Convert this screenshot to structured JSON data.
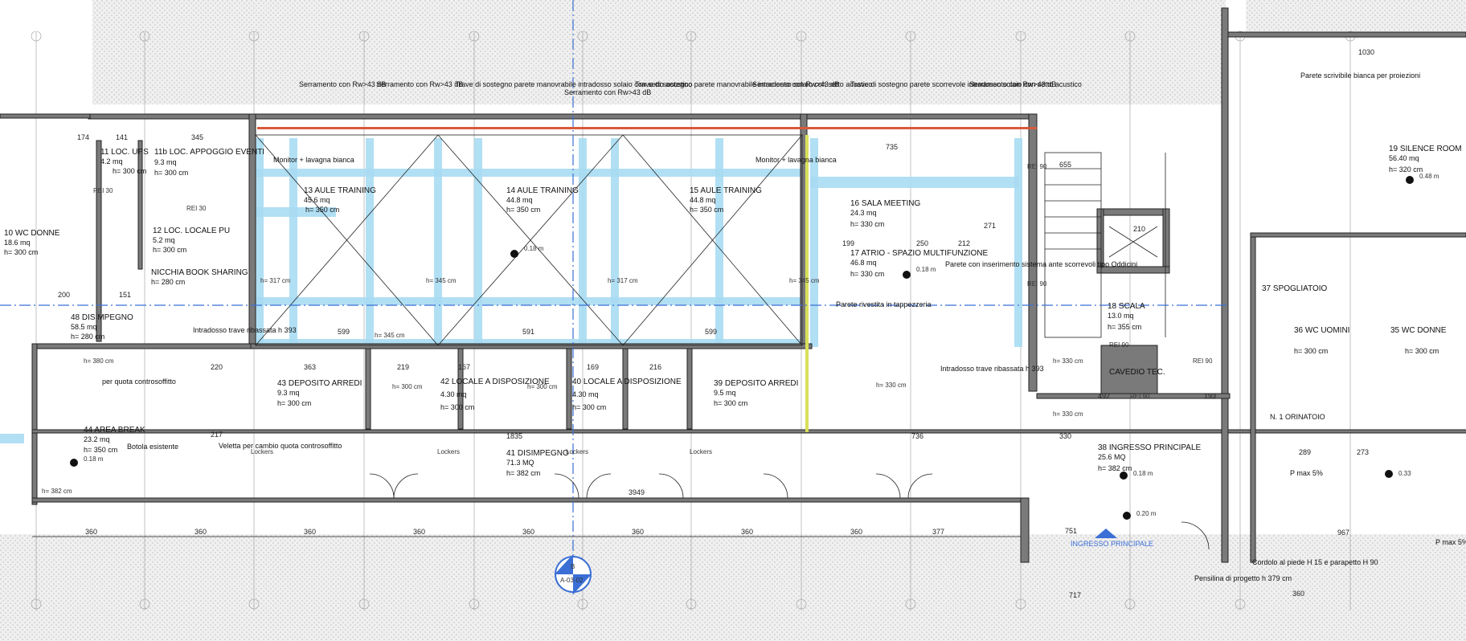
{
  "rooms": [
    {
      "id": "r1",
      "name": "11 LOC. UPS",
      "area": "4.2 mq",
      "height": "h= 300 cm"
    },
    {
      "id": "r2",
      "name": "11b LOC. APPOGGIO EVENTI",
      "area": "9.3 mq",
      "height": "h= 300 cm"
    },
    {
      "id": "r3",
      "name": "12 LOC. LOCALE PU",
      "area": "5.2 mq",
      "height": "h= 300 cm"
    },
    {
      "id": "r4",
      "name": "NICCHIA BOOK SHARING",
      "area": "",
      "height": "h= 280 cm"
    },
    {
      "id": "r5",
      "name": "10 WC DONNE",
      "area": "18.6 mq",
      "height": "h= 300 cm"
    },
    {
      "id": "r6",
      "name": "48 DISIMPEGNO",
      "area": "58.5 mq",
      "height": "h= 280 cm"
    },
    {
      "id": "r7",
      "name": "13 AULE TRAINING",
      "area": "45.6 mq",
      "height": "h= 350 cm"
    },
    {
      "id": "r8",
      "name": "14 AULE TRAINING",
      "area": "44.8 mq",
      "height": "h= 350 cm"
    },
    {
      "id": "r9",
      "name": "15 AULE TRAINING",
      "area": "44.8 mq",
      "height": "h= 350 cm"
    },
    {
      "id": "r10",
      "name": "16 SALA MEETING",
      "area": "24.3 mq",
      "height": "h= 330 cm"
    },
    {
      "id": "r11",
      "name": "17 ATRIO - SPAZIO MULTIFUNZIONE",
      "area": "46.8 mq",
      "height": "h= 330 cm"
    },
    {
      "id": "r12",
      "name": "18 SCALA",
      "area": "13.0 mq",
      "height": "h= 355 cm"
    },
    {
      "id": "r13",
      "name": "19 SILENCE ROOM",
      "area": "56.40 mq",
      "height": "h= 320 cm"
    },
    {
      "id": "r14",
      "name": "43 DEPOSITO ARREDI",
      "area": "9.3 mq",
      "height": "h= 300 cm"
    },
    {
      "id": "r15",
      "name": "42 LOCALE A DISPOSIZIONE",
      "area": "4.30 mq",
      "height": "h= 300 cm"
    },
    {
      "id": "r16",
      "name": "40 LOCALE A DISPOSIZIONE",
      "area": "4.30 mq",
      "height": "h= 300 cm"
    },
    {
      "id": "r17",
      "name": "39 DEPOSITO ARREDI",
      "area": "9.5 mq",
      "height": "h= 300 cm"
    },
    {
      "id": "r18",
      "name": "44 AREA BREAK",
      "area": "23.2 mq",
      "height": "h= 350 cm"
    },
    {
      "id": "r19",
      "name": "41 DISIMPEGNO",
      "area": "71.3 MQ",
      "height": "h= 382 cm"
    },
    {
      "id": "r20",
      "name": "38 INGRESSO PRINCIPALE",
      "area": "25.6 MQ",
      "height": "h= 382 cm"
    },
    {
      "id": "r21",
      "name": "37 SPOGLIATOIO",
      "area": "",
      "height": ""
    },
    {
      "id": "r22",
      "name": "36 WC UOMINI",
      "area": "",
      "height": "h= 300 cm"
    },
    {
      "id": "r23",
      "name": "35 WC DONNE",
      "area": "",
      "height": "h= 300 cm"
    },
    {
      "id": "r24",
      "name": "CAVEDIO TEC.",
      "area": "",
      "height": ""
    },
    {
      "id": "r25",
      "name": "N. 1 ORINATOIO",
      "area": "",
      "height": ""
    }
  ],
  "notes": {
    "serramento_1": "Serramento con Rw>43 dB",
    "serramento_2": "Serramento con Rw>43 dB",
    "trave_1": "Trave di sostegno parete manovrabile intradosso solaio con setto acustico",
    "serramento_3": "Serramento con Rw>43 dB",
    "trave_2": "Trave di sostegno parete manovrabile intradosso solaio con setto acustico",
    "serramento_4": "Serramento con Rw>43 dB",
    "trave_3": "Trave di sostegno parete scorrevole intradosso solaio con setto acustico",
    "serramento_5": "Serramento con Rw>43 dB",
    "parete_scrivibile": "Parete scrivibile bianca per proiezioni",
    "monitor_1": "Monitor + lavagna bianca",
    "monitor_2": "Monitor + lavagna bianca",
    "parete_inserimento": "Parete con inserimento sistema ante scorrevoli tipo Oddicini",
    "parete_rivestita": "Parete rivestita in tappezzeria",
    "intradosso_1": "Intradosso trave ribassata h 393",
    "intradosso_2": "Intradosso trave ribassata h 393",
    "veletta": "Veletta per cambio quota controsoffitto",
    "botola": "Botola esistente",
    "per_quota": "per quota controsoffitto",
    "cordolo": "Cordolo al piede H 15 e parapetto H 90",
    "pensilina": "Pensilina di progetto h 379 cm",
    "ingresso": "INGRESSO PRINCIPALE",
    "p_max_1": "P max 5%",
    "p_max_2": "P max 5%",
    "lockers": "Lockers",
    "section_tag": "A-03-02",
    "section_letter": "B"
  },
  "levels": [
    "0.18 m",
    "0.18 m",
    "0.18 m",
    "0.18 m",
    "0.33",
    "0.20 m",
    "0.48 m"
  ],
  "dimensions": {
    "bottom": [
      "360",
      "360",
      "360",
      "360",
      "360",
      "360",
      "360",
      "360",
      "377"
    ],
    "mid": [
      "599",
      "591",
      "599",
      "363",
      "219",
      "167",
      "169",
      "216",
      "735",
      "655",
      "210"
    ],
    "long": [
      "1835",
      "3949",
      "736",
      "717",
      "360",
      "967",
      "1030"
    ],
    "misc": [
      "345",
      "141",
      "174",
      "200",
      "151",
      "220",
      "217",
      "492",
      "193",
      "289",
      "273",
      "250",
      "212",
      "199",
      "271",
      "330",
      "751"
    ]
  },
  "fire_ratings": [
    "REI 30",
    "REI 90",
    "REI 90",
    "REI 90",
    "REI 90",
    "REI 90",
    "REI 30"
  ],
  "heights": [
    "h= 317 cm",
    "h= 345 cm",
    "h= 317 cm",
    "h= 345 cm",
    "h= 345 cm",
    "h= 300 cm",
    "h= 300 cm",
    "h= 330 cm",
    "h= 330 cm",
    "h= 330 cm",
    "h= 382 cm",
    "h= 382 cm",
    "h= 380 cm"
  ],
  "colors": {
    "wall": "#7a7a7a",
    "ac_duct": "#a9dcf2",
    "axis": "#3b6fd6",
    "hatch": "#cccccc",
    "accent_yellow": "#d8e05a",
    "accent_red": "#d85a3a"
  }
}
